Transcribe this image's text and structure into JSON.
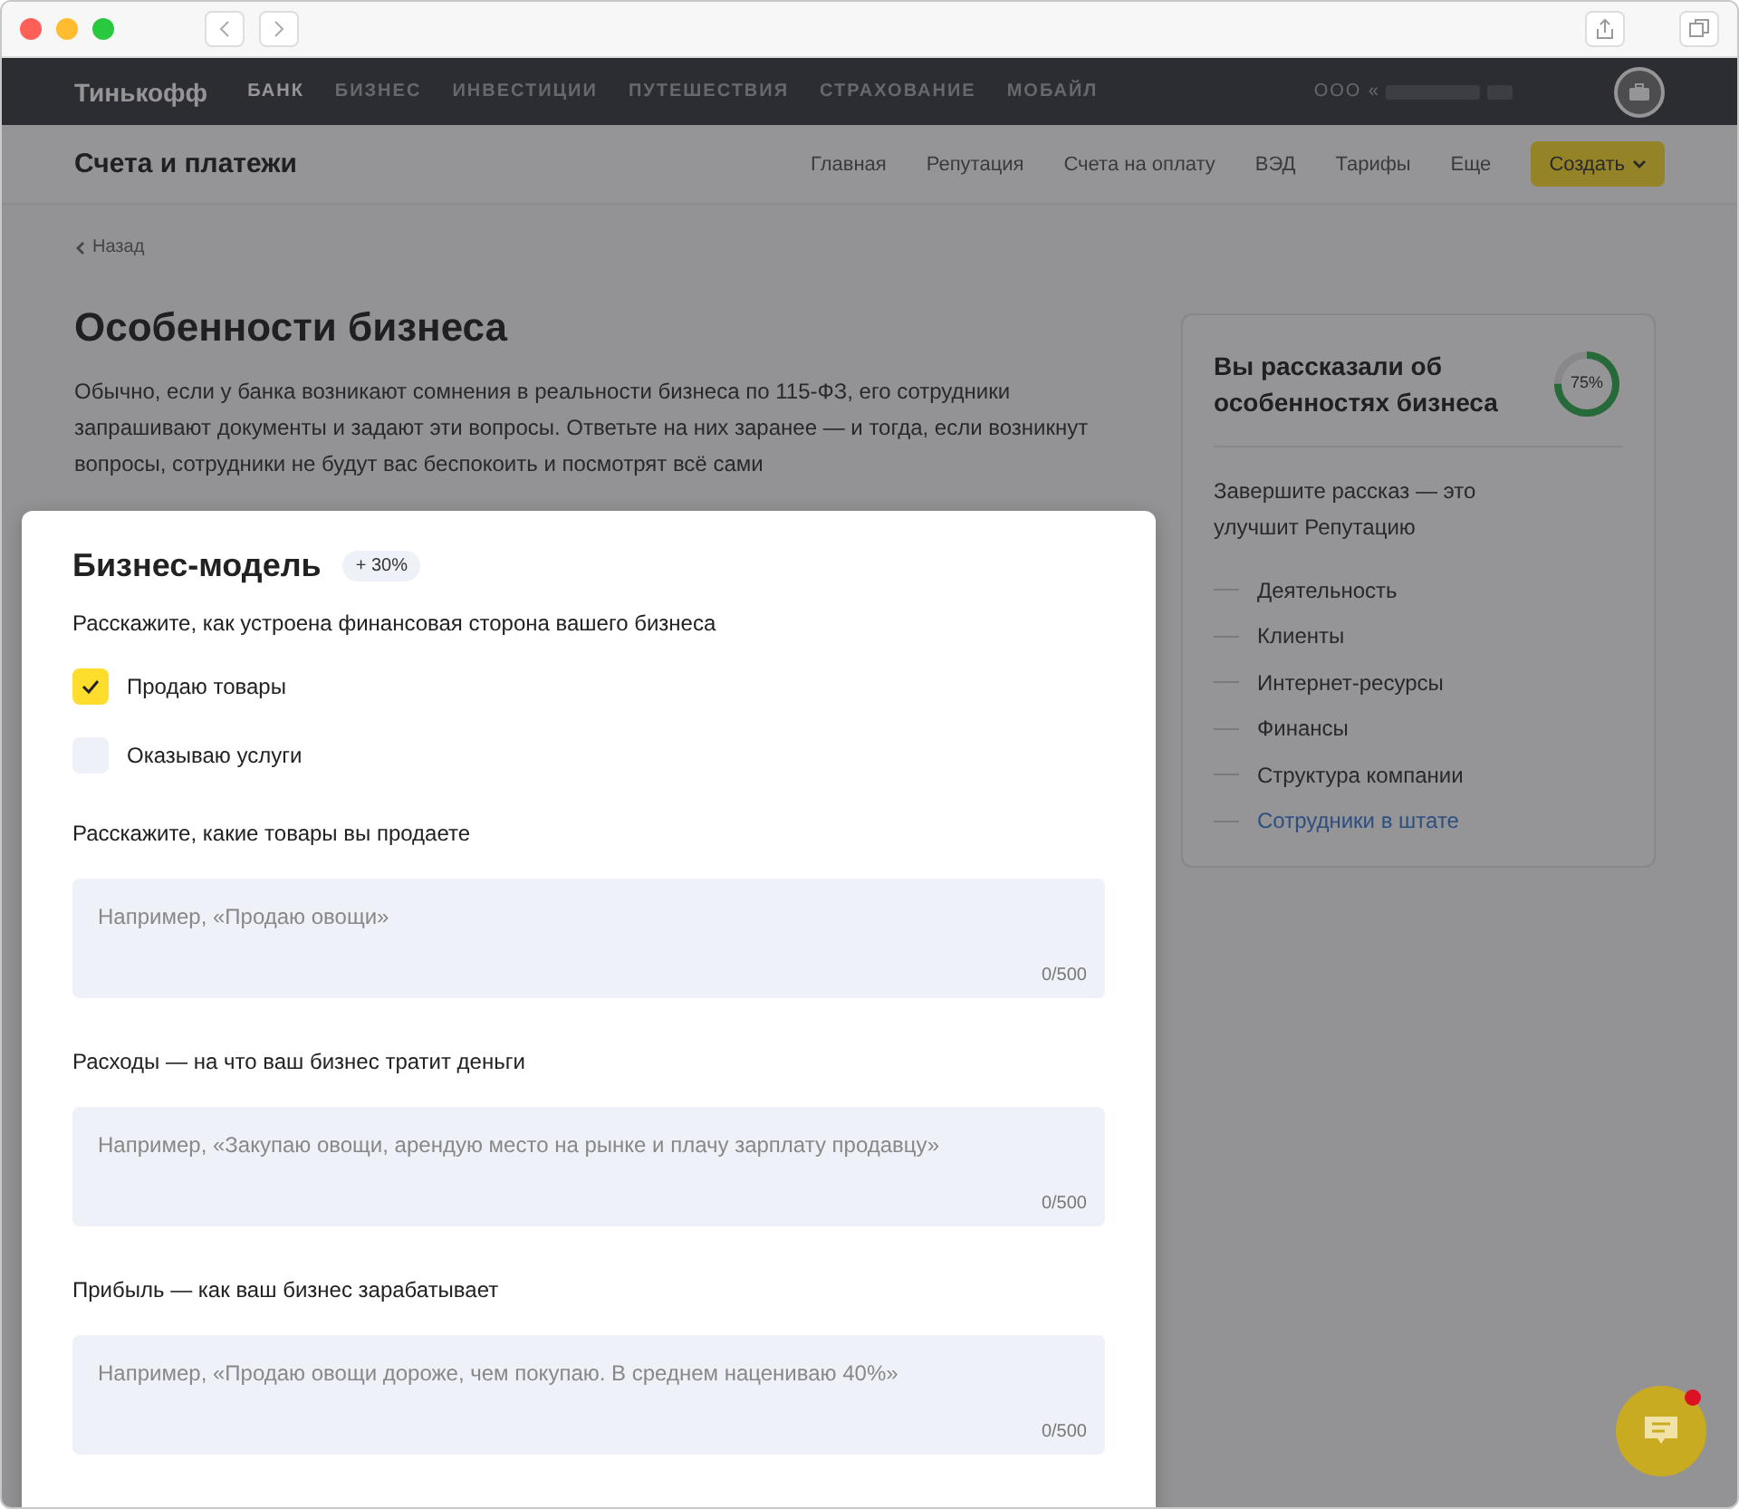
{
  "top_nav": {
    "brand": "Тинькофф",
    "items": [
      {
        "label": "БАНК",
        "selected": true
      },
      {
        "label": "БИЗНЕС",
        "selected": false
      },
      {
        "label": "ИНВЕСТИЦИИ",
        "selected": false
      },
      {
        "label": "ПУТЕШЕСТВИЯ",
        "selected": false
      },
      {
        "label": "СТРАХОВАНИЕ",
        "selected": false
      },
      {
        "label": "МОБАЙЛ",
        "selected": false
      }
    ],
    "account": "ООО «"
  },
  "subheader": {
    "title": "Счета и платежи",
    "links": [
      "Главная",
      "Репутация",
      "Счета на оплату",
      "ВЭД",
      "Тарифы",
      "Еще"
    ],
    "create_button": "Создать"
  },
  "back_link": "Назад",
  "page_title": "Особенности бизнеса",
  "intro": "Обычно, если у банка возникают сомнения в реальности бизнеса по 115-ФЗ, его сотрудники запрашивают документы и задают эти вопросы. Ответьте на них заранее — и тогда, если возникнут вопросы, сотрудники не будут вас беспокоить и посмотрят всё сами",
  "progress_card": {
    "title": "Вы рассказали об особенностях бизнеса",
    "percent": "75%",
    "level": 0.75,
    "subtitle": "Завершите рассказ — это улучшит Репутацию",
    "items": [
      {
        "label": "Деятельность",
        "kind": "text"
      },
      {
        "label": "Клиенты",
        "kind": "text"
      },
      {
        "label": "Интернет-ресурсы",
        "kind": "text"
      },
      {
        "label": "Финансы",
        "kind": "text"
      },
      {
        "label": "Структура компании",
        "kind": "text"
      },
      {
        "label": "Сотрудники в штате",
        "kind": "link"
      }
    ]
  },
  "modal": {
    "title": "Бизнес-модель",
    "badge": "+ 30%",
    "question": "Расскажите, как устроена финансовая сторона вашего бизнеса",
    "options": [
      {
        "label": "Продаю товары",
        "checked": true
      },
      {
        "label": "Оказываю услуги",
        "checked": false
      }
    ],
    "fields": [
      {
        "label": "Расскажите, какие товары вы продаете",
        "placeholder": "Например, «Продаю овощи»",
        "counter": "0/500"
      },
      {
        "label": "Расходы — на что ваш бизнес тратит деньги",
        "placeholder": "Например, «Закупаю овощи, арендую место на рынке и плачу зарплату продавцу»",
        "counter": "0/500"
      },
      {
        "label": "Прибыль — как ваш бизнес зарабатывает",
        "placeholder": "Например, «Продаю овощи дороже, чем покупаю. В среднем нацениваю 40%»",
        "counter": "0/500"
      }
    ]
  },
  "chat": {
    "unread": true
  }
}
